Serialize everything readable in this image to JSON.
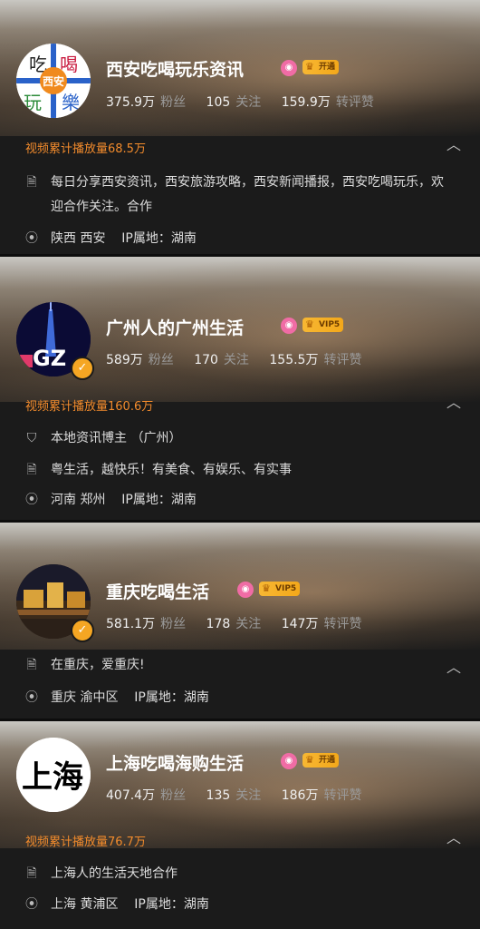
{
  "cards": [
    {
      "name": "西安吃喝玩乐资讯",
      "badge_tag": "开通",
      "avatar_text": [
        "吃",
        "喝",
        "玩",
        "樂",
        "西安"
      ],
      "followers": "375.9万",
      "followers_label": "粉丝",
      "following": "105",
      "following_label": "关注",
      "likes": "159.9万",
      "likes_label": "转评赞",
      "play": "视频累计播放量68.5万",
      "desc_icon": "document-icon",
      "desc": "每日分享西安资讯，西安旅游攻略，西安新闻播报，西安吃喝玩乐，欢迎合作关注。合作",
      "location": "陕西 西安",
      "ip": "IP属地：湖南"
    },
    {
      "name": "广州人的广州生活",
      "badge_tag": "VIP5",
      "avatar_text": [
        "GZ"
      ],
      "followers": "589万",
      "followers_label": "粉丝",
      "following": "170",
      "following_label": "关注",
      "likes": "155.5万",
      "likes_label": "转评赞",
      "play": "视频累计播放量160.6万",
      "verify": "本地资讯博主 （广州）",
      "desc": "粤生活，越快乐！有美食、有娱乐、有实事",
      "location": "河南 郑州",
      "ip": "IP属地：湖南"
    },
    {
      "name": "重庆吃喝生活",
      "badge_tag": "VIP5",
      "followers": "581.1万",
      "followers_label": "粉丝",
      "following": "178",
      "following_label": "关注",
      "likes": "147万",
      "likes_label": "转评赞",
      "desc": "在重庆，爱重庆!",
      "location": "重庆 渝中区",
      "ip": "IP属地：湖南"
    },
    {
      "name": "上海吃喝海购生活",
      "badge_tag": "开通",
      "avatar_text": [
        "上海"
      ],
      "followers": "407.4万",
      "followers_label": "粉丝",
      "following": "135",
      "following_label": "关注",
      "likes": "186万",
      "likes_label": "转评赞",
      "play": "视频累计播放量76.7万",
      "desc": "上海人的生活天地合作",
      "location": "上海 黄浦区",
      "ip": "IP属地：湖南"
    }
  ],
  "colors": {
    "accent_orange": "#f28b2c",
    "pink_badge": "#f06ca5",
    "vip_gold": "#f7b733"
  }
}
